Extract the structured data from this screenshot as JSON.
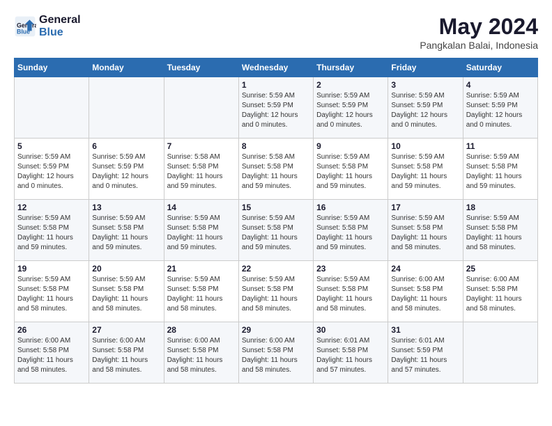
{
  "header": {
    "logo_line1": "General",
    "logo_line2": "Blue",
    "month_year": "May 2024",
    "location": "Pangkalan Balai, Indonesia"
  },
  "weekdays": [
    "Sunday",
    "Monday",
    "Tuesday",
    "Wednesday",
    "Thursday",
    "Friday",
    "Saturday"
  ],
  "weeks": [
    [
      {
        "day": "",
        "info": ""
      },
      {
        "day": "",
        "info": ""
      },
      {
        "day": "",
        "info": ""
      },
      {
        "day": "1",
        "info": "Sunrise: 5:59 AM\nSunset: 5:59 PM\nDaylight: 12 hours\nand 0 minutes."
      },
      {
        "day": "2",
        "info": "Sunrise: 5:59 AM\nSunset: 5:59 PM\nDaylight: 12 hours\nand 0 minutes."
      },
      {
        "day": "3",
        "info": "Sunrise: 5:59 AM\nSunset: 5:59 PM\nDaylight: 12 hours\nand 0 minutes."
      },
      {
        "day": "4",
        "info": "Sunrise: 5:59 AM\nSunset: 5:59 PM\nDaylight: 12 hours\nand 0 minutes."
      }
    ],
    [
      {
        "day": "5",
        "info": "Sunrise: 5:59 AM\nSunset: 5:59 PM\nDaylight: 12 hours\nand 0 minutes."
      },
      {
        "day": "6",
        "info": "Sunrise: 5:59 AM\nSunset: 5:59 PM\nDaylight: 12 hours\nand 0 minutes."
      },
      {
        "day": "7",
        "info": "Sunrise: 5:58 AM\nSunset: 5:58 PM\nDaylight: 11 hours\nand 59 minutes."
      },
      {
        "day": "8",
        "info": "Sunrise: 5:58 AM\nSunset: 5:58 PM\nDaylight: 11 hours\nand 59 minutes."
      },
      {
        "day": "9",
        "info": "Sunrise: 5:59 AM\nSunset: 5:58 PM\nDaylight: 11 hours\nand 59 minutes."
      },
      {
        "day": "10",
        "info": "Sunrise: 5:59 AM\nSunset: 5:58 PM\nDaylight: 11 hours\nand 59 minutes."
      },
      {
        "day": "11",
        "info": "Sunrise: 5:59 AM\nSunset: 5:58 PM\nDaylight: 11 hours\nand 59 minutes."
      }
    ],
    [
      {
        "day": "12",
        "info": "Sunrise: 5:59 AM\nSunset: 5:58 PM\nDaylight: 11 hours\nand 59 minutes."
      },
      {
        "day": "13",
        "info": "Sunrise: 5:59 AM\nSunset: 5:58 PM\nDaylight: 11 hours\nand 59 minutes."
      },
      {
        "day": "14",
        "info": "Sunrise: 5:59 AM\nSunset: 5:58 PM\nDaylight: 11 hours\nand 59 minutes."
      },
      {
        "day": "15",
        "info": "Sunrise: 5:59 AM\nSunset: 5:58 PM\nDaylight: 11 hours\nand 59 minutes."
      },
      {
        "day": "16",
        "info": "Sunrise: 5:59 AM\nSunset: 5:58 PM\nDaylight: 11 hours\nand 59 minutes."
      },
      {
        "day": "17",
        "info": "Sunrise: 5:59 AM\nSunset: 5:58 PM\nDaylight: 11 hours\nand 58 minutes."
      },
      {
        "day": "18",
        "info": "Sunrise: 5:59 AM\nSunset: 5:58 PM\nDaylight: 11 hours\nand 58 minutes."
      }
    ],
    [
      {
        "day": "19",
        "info": "Sunrise: 5:59 AM\nSunset: 5:58 PM\nDaylight: 11 hours\nand 58 minutes."
      },
      {
        "day": "20",
        "info": "Sunrise: 5:59 AM\nSunset: 5:58 PM\nDaylight: 11 hours\nand 58 minutes."
      },
      {
        "day": "21",
        "info": "Sunrise: 5:59 AM\nSunset: 5:58 PM\nDaylight: 11 hours\nand 58 minutes."
      },
      {
        "day": "22",
        "info": "Sunrise: 5:59 AM\nSunset: 5:58 PM\nDaylight: 11 hours\nand 58 minutes."
      },
      {
        "day": "23",
        "info": "Sunrise: 5:59 AM\nSunset: 5:58 PM\nDaylight: 11 hours\nand 58 minutes."
      },
      {
        "day": "24",
        "info": "Sunrise: 6:00 AM\nSunset: 5:58 PM\nDaylight: 11 hours\nand 58 minutes."
      },
      {
        "day": "25",
        "info": "Sunrise: 6:00 AM\nSunset: 5:58 PM\nDaylight: 11 hours\nand 58 minutes."
      }
    ],
    [
      {
        "day": "26",
        "info": "Sunrise: 6:00 AM\nSunset: 5:58 PM\nDaylight: 11 hours\nand 58 minutes."
      },
      {
        "day": "27",
        "info": "Sunrise: 6:00 AM\nSunset: 5:58 PM\nDaylight: 11 hours\nand 58 minutes."
      },
      {
        "day": "28",
        "info": "Sunrise: 6:00 AM\nSunset: 5:58 PM\nDaylight: 11 hours\nand 58 minutes."
      },
      {
        "day": "29",
        "info": "Sunrise: 6:00 AM\nSunset: 5:58 PM\nDaylight: 11 hours\nand 58 minutes."
      },
      {
        "day": "30",
        "info": "Sunrise: 6:01 AM\nSunset: 5:58 PM\nDaylight: 11 hours\nand 57 minutes."
      },
      {
        "day": "31",
        "info": "Sunrise: 6:01 AM\nSunset: 5:59 PM\nDaylight: 11 hours\nand 57 minutes."
      },
      {
        "day": "",
        "info": ""
      }
    ]
  ]
}
